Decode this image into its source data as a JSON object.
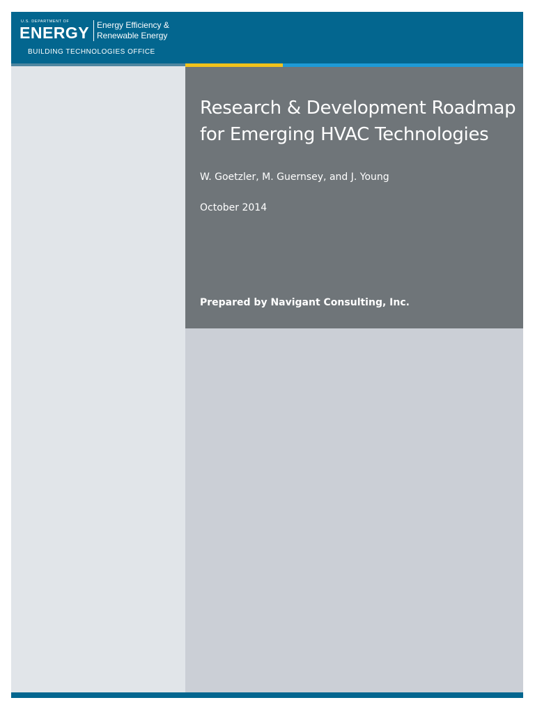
{
  "header": {
    "logo": {
      "department": "U.S. DEPARTMENT OF",
      "agency": "ENERGY",
      "office_line1": "Energy Efficiency &",
      "office_line2": "Renewable Energy",
      "program": "BUILDING TECHNOLOGIES OFFICE"
    }
  },
  "cover": {
    "title": "Research & Development Roadmap for Emerging HVAC Technologies",
    "authors": "W. Goetzler, M. Guernsey, and J. Young",
    "date": "October 2014",
    "prepared_by": "Prepared by Navigant Consulting, Inc."
  },
  "colors": {
    "header_blue": "#03668f",
    "accent_gold": "#f1c21b",
    "accent_blue": "#1e9ad6",
    "title_panel_gray": "#6f7579",
    "left_column_gray": "#e1e5e9",
    "lower_panel_gray": "#cbcfd6"
  }
}
